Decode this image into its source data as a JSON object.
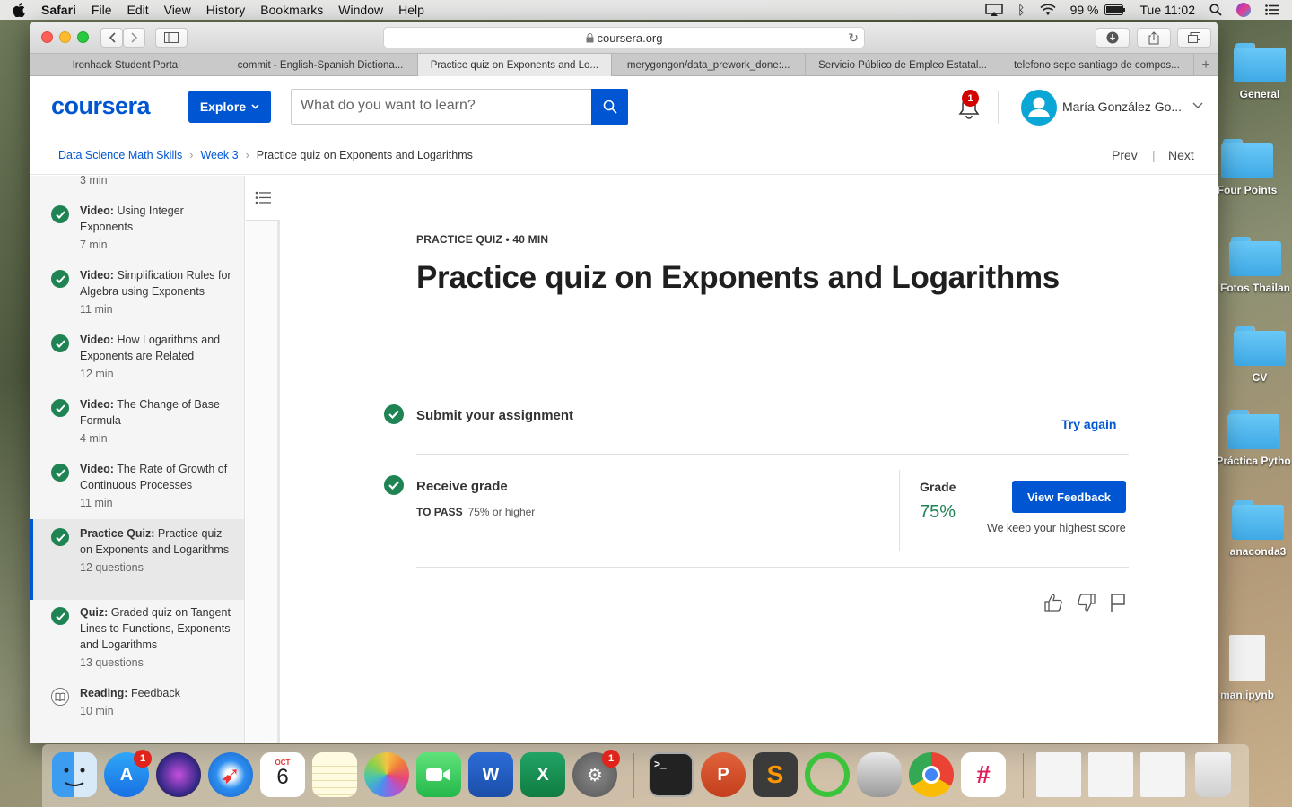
{
  "menubar": {
    "app": "Safari",
    "items": [
      "File",
      "Edit",
      "View",
      "History",
      "Bookmarks",
      "Window",
      "Help"
    ],
    "battery": "99 %",
    "clock": "Tue 11:02"
  },
  "desktop": [
    "General",
    "Four Points",
    "Fotos Thailan",
    "CV",
    "Práctica Pytho",
    "anaconda3",
    "man.ipynb"
  ],
  "browser": {
    "url": "coursera.org",
    "tabs": [
      "Ironhack Student Portal",
      "commit - English-Spanish Dictiona...",
      "Practice quiz on Exponents and Lo...",
      "merygongon/data_prework_done:...",
      "Servicio Público de Empleo Estatal...",
      "telefono sepe santiago de compos..."
    ]
  },
  "header": {
    "logo": "coursera",
    "explore": "Explore",
    "search_placeholder": "What do you want to learn?",
    "notifications": "1",
    "user": "María González Go..."
  },
  "breadcrumb": {
    "course": "Data Science Math Skills",
    "week": "Week 3",
    "current": "Practice quiz on Exponents and Logarithms",
    "prev": "Prev",
    "next": "Next"
  },
  "sidebar": {
    "top_meta": "3 min",
    "items": [
      {
        "type": "Video:",
        "title": "Using Integer Exponents",
        "meta": "7 min"
      },
      {
        "type": "Video:",
        "title": "Simplification Rules for Algebra using Exponents",
        "meta": "11 min"
      },
      {
        "type": "Video:",
        "title": "How Logarithms and Exponents are Related",
        "meta": "12 min"
      },
      {
        "type": "Video:",
        "title": "The Change of Base Formula",
        "meta": "4 min"
      },
      {
        "type": "Video:",
        "title": "The Rate of Growth of Continuous Processes",
        "meta": "11 min"
      },
      {
        "type": "Practice Quiz:",
        "title": "Practice quiz on Exponents and Logarithms",
        "meta": "12 questions"
      },
      {
        "type": "Quiz:",
        "title": "Graded quiz on Tangent Lines to Functions, Exponents and Logarithms",
        "meta": "13 questions"
      },
      {
        "type": "Reading:",
        "title": "Feedback",
        "meta": "10 min"
      }
    ]
  },
  "main": {
    "label": "PRACTICE QUIZ • 40 MIN",
    "title": "Practice quiz on Exponents and Logarithms",
    "submit": "Submit your assignment",
    "try_again": "Try again",
    "receive": "Receive grade",
    "to_pass_label": "TO PASS",
    "to_pass_value": "75% or higher",
    "grade_label": "Grade",
    "grade_value": "75%",
    "view_feedback": "View Feedback",
    "keep_note": "We keep your highest score"
  },
  "dock": {
    "calendar_month": "OCT",
    "calendar_day": "6",
    "appstore_badge": "1",
    "settings_badge": "1"
  }
}
